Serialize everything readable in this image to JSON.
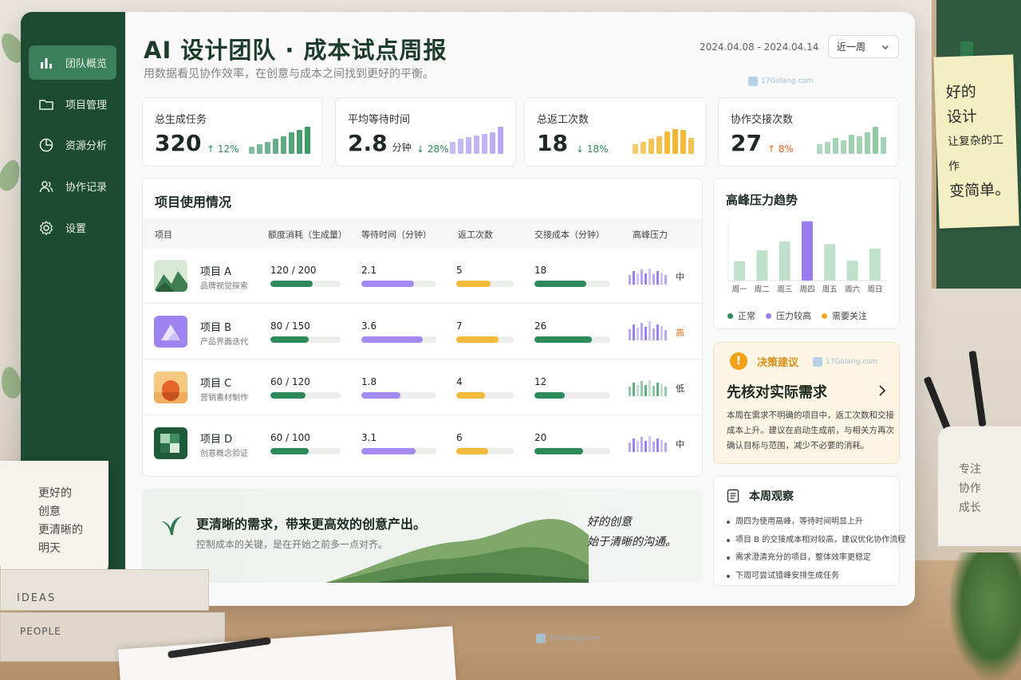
{
  "app": {
    "title": "AI 设计团队 · 成本试点周报",
    "subtitle": "用数据看见协作效率，在创意与成本之间找到更好的平衡。",
    "date_range": "2024.04.08 - 2024.04.14",
    "period": "近一周",
    "watermark": "17Golang.com"
  },
  "sidebar": {
    "items": [
      {
        "label": "团队概览",
        "icon": "bar-chart-icon",
        "active": true
      },
      {
        "label": "项目管理",
        "icon": "folder-icon"
      },
      {
        "label": "资源分析",
        "icon": "pie-chart-icon"
      },
      {
        "label": "协作记录",
        "icon": "users-icon"
      },
      {
        "label": "设置",
        "icon": "gear-icon"
      }
    ]
  },
  "kpis": [
    {
      "label": "总生成任务",
      "value": "320",
      "unit": "",
      "delta": "12%",
      "direction": "up",
      "delta_color": "#2e8a5a",
      "color": "#3f9a6a",
      "bars": [
        0.25,
        0.35,
        0.45,
        0.55,
        0.65,
        0.78,
        0.88,
        1.0
      ]
    },
    {
      "label": "平均等待时间",
      "value": "2.8",
      "unit": "分钟",
      "delta": "28%",
      "direction": "down",
      "delta_color": "#2e8a5a",
      "color": "#b7a7f3",
      "bars": [
        0.45,
        0.55,
        0.62,
        0.68,
        0.74,
        0.8,
        1.0
      ]
    },
    {
      "label": "总返工次数",
      "value": "18",
      "unit": "",
      "delta": "18%",
      "direction": "down",
      "delta_color": "#2e8a5a",
      "color": "#f3b52b",
      "bars": [
        0.35,
        0.45,
        0.55,
        0.65,
        0.82,
        0.92,
        0.88,
        0.6
      ]
    },
    {
      "label": "协作交接次数",
      "value": "27",
      "unit": "",
      "delta": "8%",
      "direction": "up",
      "delta_color": "#e8601c",
      "color": "#8fcaa5",
      "bars": [
        0.35,
        0.45,
        0.6,
        0.5,
        0.72,
        0.65,
        0.78,
        1.0,
        0.62
      ]
    }
  ],
  "projects_table": {
    "title": "项目使用情况",
    "columns": [
      "项目",
      "额度消耗（生成量）",
      "等待时间（分钟）",
      "返工次数",
      "交接成本（分钟）",
      "高峰压力"
    ],
    "rows": [
      {
        "name": "项目 A",
        "desc": "品牌视觉探索",
        "quota": "120 / 200",
        "quota_pct": 0.6,
        "wait": "2.1",
        "wait_pct": 0.7,
        "rework": "5",
        "rework_pct": 0.6,
        "handoff": "18",
        "handoff_pct": 0.68,
        "pressure": "中",
        "pressure_color": "#333333",
        "thumb": "mountains"
      },
      {
        "name": "项目 B",
        "desc": "产品界面迭代",
        "quota": "80 / 150",
        "quota_pct": 0.55,
        "wait": "3.6",
        "wait_pct": 0.82,
        "rework": "7",
        "rework_pct": 0.74,
        "handoff": "26",
        "handoff_pct": 0.76,
        "pressure": "高",
        "pressure_color": "#e8701c",
        "thumb": "triangle"
      },
      {
        "name": "项目 C",
        "desc": "营销素材制作",
        "quota": "60 / 120",
        "quota_pct": 0.5,
        "wait": "1.8",
        "wait_pct": 0.52,
        "rework": "4",
        "rework_pct": 0.5,
        "handoff": "12",
        "handoff_pct": 0.4,
        "pressure": "低",
        "pressure_color": "#333333",
        "thumb": "sun"
      },
      {
        "name": "项目 D",
        "desc": "创意概念验证",
        "quota": "60 / 100",
        "quota_pct": 0.55,
        "wait": "3.1",
        "wait_pct": 0.72,
        "rework": "6",
        "rework_pct": 0.56,
        "handoff": "20",
        "handoff_pct": 0.64,
        "pressure": "中",
        "pressure_color": "#333333",
        "thumb": "blocks"
      }
    ]
  },
  "peak": {
    "title": "高峰压力趋势",
    "legend": [
      {
        "label": "正常",
        "color": "#2e8a5a"
      },
      {
        "label": "压力较高",
        "color": "#9b7cf0"
      },
      {
        "label": "需要关注",
        "color": "#f3a625"
      }
    ]
  },
  "chart_data": {
    "type": "bar",
    "title": "高峰压力趋势",
    "categories": [
      "周一",
      "周二",
      "周三",
      "周四",
      "周五",
      "周六",
      "周日"
    ],
    "values": [
      32,
      50,
      65,
      98,
      60,
      33,
      53
    ],
    "highlight_index": 3,
    "ylim": [
      0,
      100
    ],
    "grid": false,
    "legend_position": "bottom"
  },
  "suggestion": {
    "label": "决策建议",
    "title": "先核对实际需求",
    "body": "本周在需求不明确的项目中，返工次数和交接成本上升。建议在启动生成前，与相关方再次确认目标与范围，减少不必要的消耗。"
  },
  "observation": {
    "title": "本周观察",
    "items": [
      "周四为使用高峰，等待时间明显上升",
      "项目 B 的交接成本相对较高，建议优化协作流程",
      "需求澄清充分的项目，整体效率更稳定",
      "下周可尝试错峰安排生成任务"
    ]
  },
  "banner": {
    "title": "更清晰的需求，带来更高效的创意产出。",
    "subtitle": "控制成本的关键，是在开始之前多一点对齐。",
    "note_line1": "好的创意",
    "note_line2": "始于清晰的沟通。"
  },
  "decor": {
    "sticky_line1": "好的",
    "sticky_line2": "设计",
    "sticky_line3": "让复杂的工作",
    "sticky_line4": "变简单。",
    "mug_left": [
      "更好的",
      "创意",
      "更清晰的",
      "明天"
    ],
    "mug_right": [
      "专注",
      "协作",
      "成长"
    ],
    "book1": "IDEAS",
    "book2": "PEOPLE"
  }
}
